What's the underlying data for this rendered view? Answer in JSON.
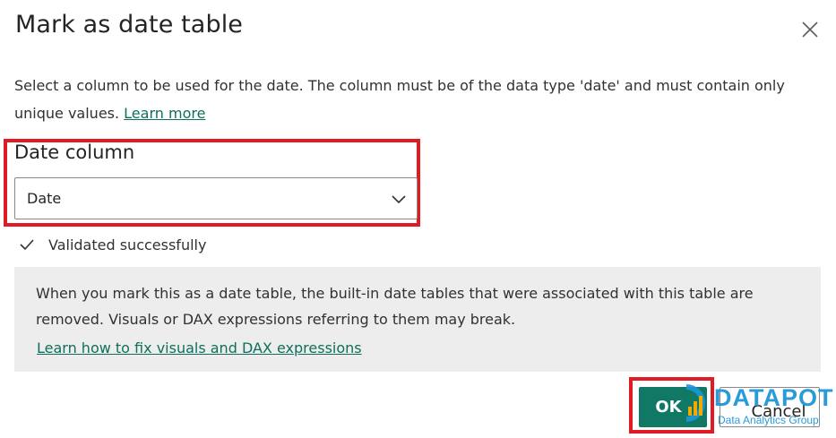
{
  "dialog": {
    "title": "Mark as date table",
    "description": "Select a column to be used for the date. The column must be of the data type 'date' and must contain only unique values.",
    "learn_more_link": "Learn more"
  },
  "date_column": {
    "label": "Date column",
    "selected_value": "Date"
  },
  "validation": {
    "status_text": "Validated successfully"
  },
  "info": {
    "text": "When you mark this as a date table, the built-in date tables that were associated with this table are removed. Visuals or DAX expressions referring to them may break.",
    "link": "Learn how to fix visuals and DAX expressions"
  },
  "buttons": {
    "ok": "OK",
    "cancel": "Cancel"
  },
  "watermark": {
    "name": "DATAPOT",
    "tagline": "Data Analytics Group"
  },
  "colors": {
    "primary_button": "#117865",
    "link": "#0f6f5c",
    "highlight": "#e01b24",
    "info_background": "#ededed",
    "watermark": "#1e96d8"
  },
  "icons": [
    "close-icon",
    "chevron-down-icon",
    "checkmark-icon"
  ]
}
